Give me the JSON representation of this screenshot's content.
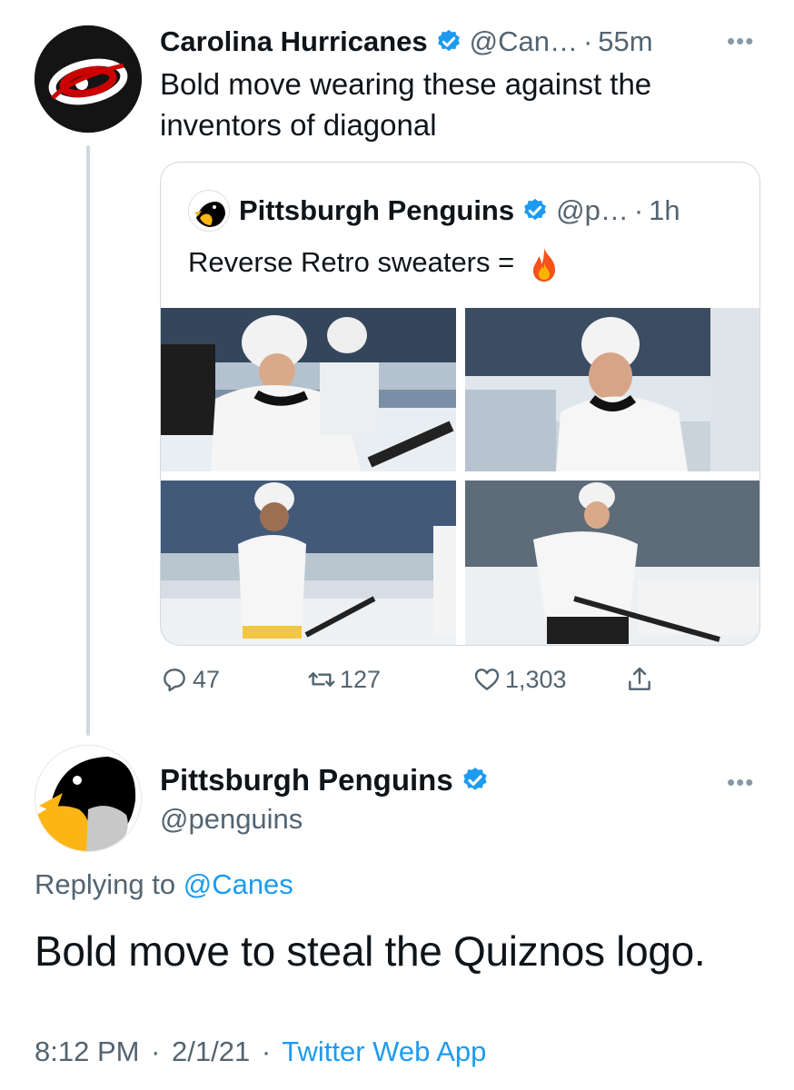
{
  "parent_tweet": {
    "author_name": "Carolina Hurricanes",
    "handle": "@Can…",
    "separator": "·",
    "time": "55m",
    "more": "•••",
    "text": "Bold move wearing these against the inventors of diagonal"
  },
  "quoted_tweet": {
    "author_name": "Pittsburgh Penguins",
    "handle": "@p…",
    "separator": "·",
    "time": "1h",
    "text": "Reverse Retro sweaters =",
    "emoji": "fire-icon",
    "photos": [
      "photo-1",
      "photo-2",
      "photo-3",
      "photo-4"
    ]
  },
  "actions": {
    "replies": "47",
    "retweets": "127",
    "likes": "1,303"
  },
  "reply_tweet": {
    "author_name": "Pittsburgh Penguins",
    "handle": "@penguins",
    "more": "•••",
    "replying_prefix": "Replying to",
    "replying_to": "@Canes",
    "text": "Bold move to steal the Quiznos logo.",
    "time": "8:12 PM",
    "date": "2/1/21",
    "separator": "·",
    "source": "Twitter Web App"
  },
  "colors": {
    "link": "#1d9bf0",
    "muted": "#536471",
    "verified": "#1d9bf0"
  }
}
